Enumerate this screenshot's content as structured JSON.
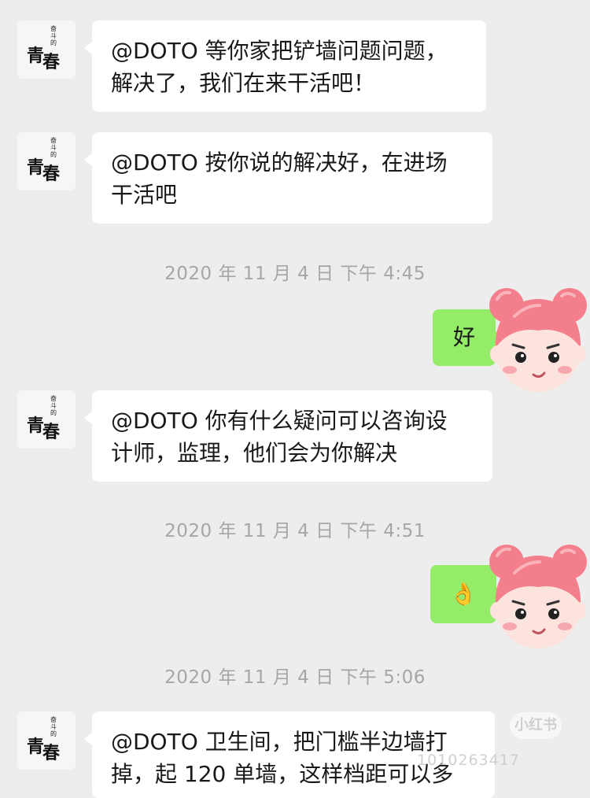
{
  "contact_avatar": {
    "small_text": "奋斗的",
    "big_text_1": "青",
    "big_text_2": "春"
  },
  "messages": [
    {
      "lines": [
        "@DOTO 等你家把铲墙问题问题，",
        "解决了，我们在来干活吧！"
      ]
    },
    {
      "lines": [
        "@DOTO 按你说的解决好，在进场",
        "干活吧"
      ]
    },
    {
      "timestamp": "2020 年 11 月 4 日  下午 4:45"
    },
    {
      "text": "好"
    },
    {
      "lines": [
        "@DOTO 你有什么疑问可以咨询设",
        "计师，监理，他们会为你解决"
      ]
    },
    {
      "timestamp": "2020 年 11 月 4 日  下午 4:51"
    },
    {
      "emoji": "👌"
    },
    {
      "timestamp": "2020 年 11 月 4 日  下午 5:06"
    },
    {
      "lines": [
        "@DOTO 卫生间，把门槛半边墙打",
        "掉，起 120 单墙，这样档距可以多"
      ]
    }
  ],
  "watermark": {
    "badge": "小红书",
    "text": "1010263417"
  },
  "colors": {
    "background": "#ededed",
    "incoming_bubble": "#ffffff",
    "outgoing_bubble": "#95ec69",
    "timestamp": "#a6a6a6"
  }
}
